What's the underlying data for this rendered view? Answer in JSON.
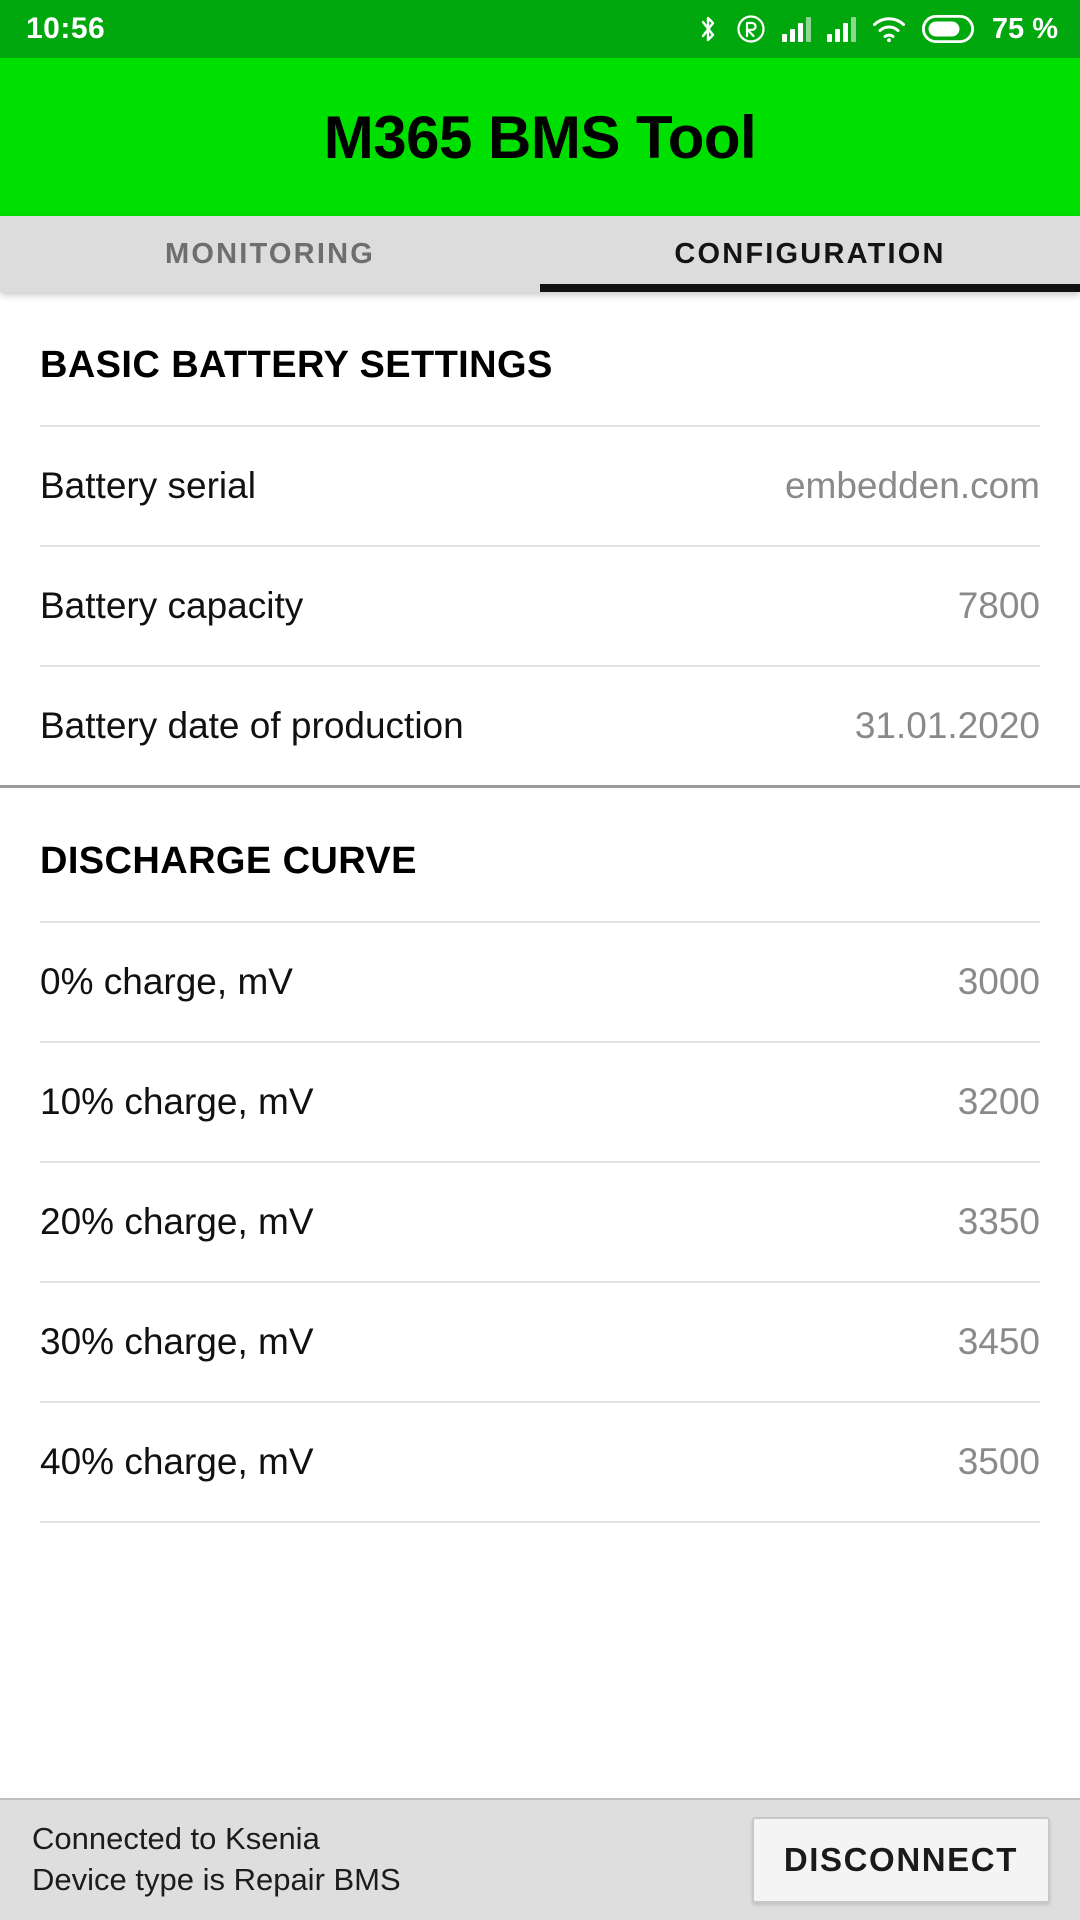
{
  "status_bar": {
    "clock": "10:56",
    "battery_percent": "75 %",
    "icons": [
      "bluetooth-icon",
      "roaming-icon",
      "signal-sim1-icon",
      "signal-sim2-icon",
      "wifi-icon",
      "battery-icon"
    ]
  },
  "app_bar": {
    "title": "M365 BMS Tool",
    "background_color": "#00E000",
    "status_bar_color": "#00A80D"
  },
  "tabs": {
    "items": [
      {
        "label": "MONITORING",
        "active": false
      },
      {
        "label": "CONFIGURATION",
        "active": true
      }
    ],
    "indicator_color": "#111111"
  },
  "sections": [
    {
      "title": "BASIC BATTERY SETTINGS",
      "rows": [
        {
          "label": "Battery serial",
          "value": "embedden.com"
        },
        {
          "label": "Battery capacity",
          "value": "7800"
        },
        {
          "label": "Battery date of production",
          "value": "31.01.2020"
        }
      ]
    },
    {
      "title": "DISCHARGE CURVE",
      "rows": [
        {
          "label": "0% charge, mV",
          "value": "3000"
        },
        {
          "label": "10% charge, mV",
          "value": "3200"
        },
        {
          "label": "20% charge, mV",
          "value": "3350"
        },
        {
          "label": "30% charge, mV",
          "value": "3450"
        },
        {
          "label": "40% charge, mV",
          "value": "3500"
        }
      ]
    }
  ],
  "bottom_bar": {
    "connection_line1": "Connected to Ksenia",
    "connection_line2": "Device type is Repair BMS",
    "disconnect_label": "DISCONNECT"
  }
}
